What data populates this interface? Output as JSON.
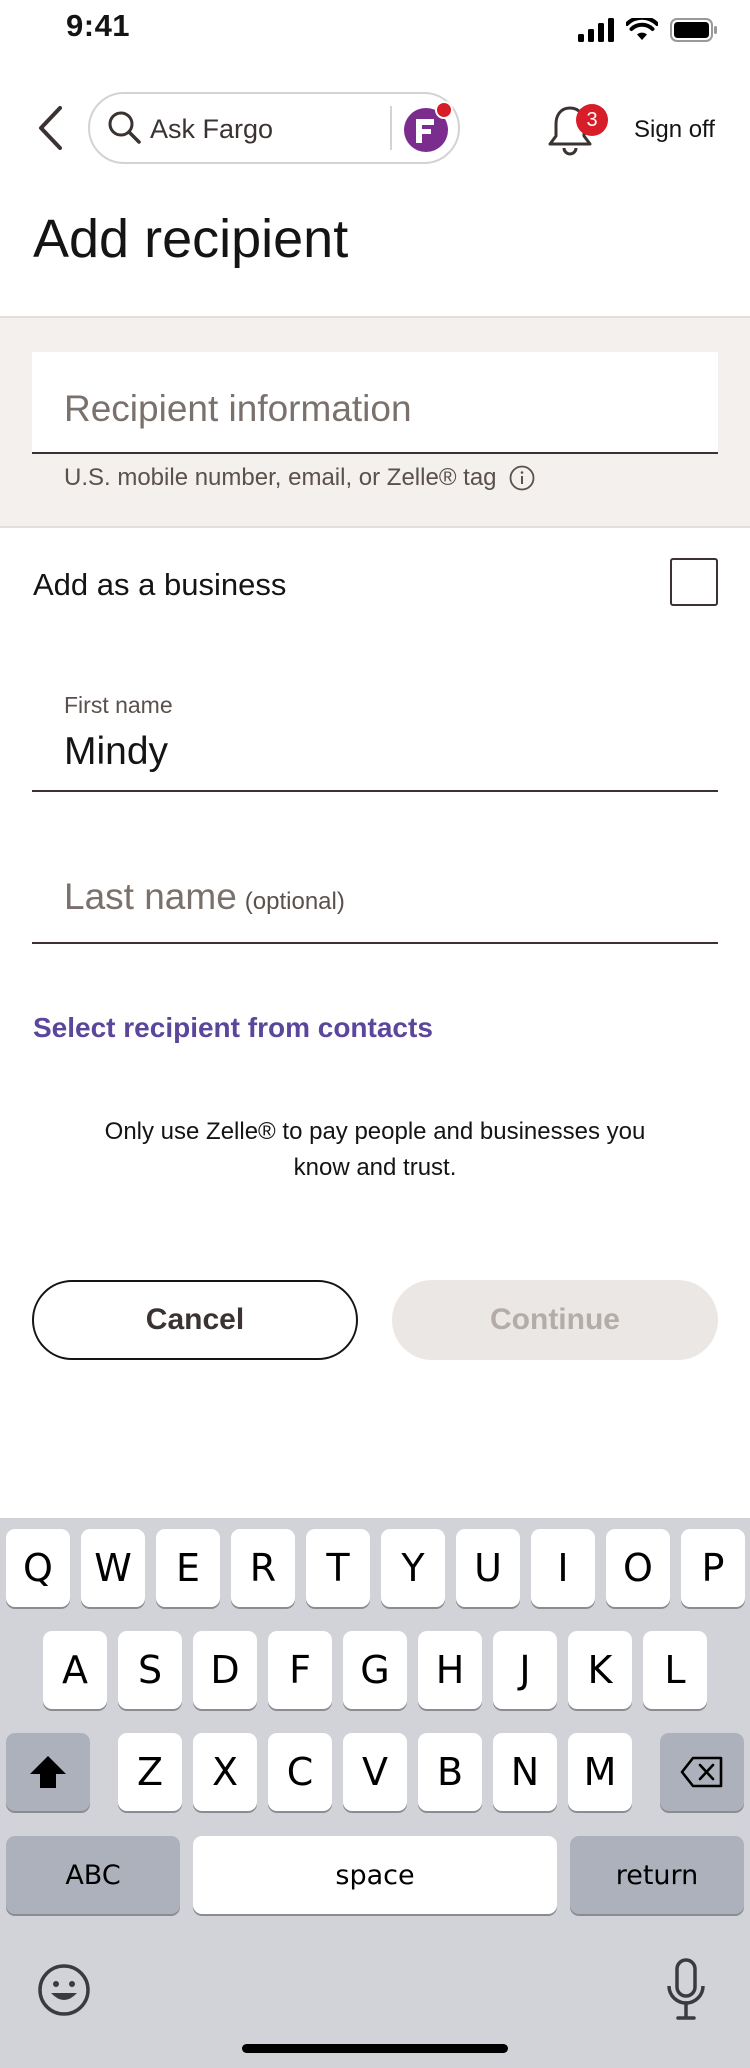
{
  "status_bar": {
    "time": "9:41"
  },
  "nav": {
    "search_text": "Ask Fargo",
    "notification_count": "3",
    "sign_off": "Sign off"
  },
  "page": {
    "title": "Add recipient"
  },
  "recipient": {
    "placeholder": "Recipient information",
    "help_text": "U.S. mobile number, email, or Zelle® tag"
  },
  "business": {
    "label": "Add as a business",
    "checked": false
  },
  "first_name": {
    "label": "First name",
    "value": "Mindy"
  },
  "last_name": {
    "placeholder": "Last name",
    "optional": "(optional)"
  },
  "contacts_link": "Select recipient from contacts",
  "disclaimer": "Only use Zelle® to pay people and businesses you know and trust.",
  "buttons": {
    "cancel": "Cancel",
    "continue": "Continue"
  },
  "keyboard": {
    "row1": [
      "Q",
      "W",
      "E",
      "R",
      "T",
      "Y",
      "U",
      "I",
      "O",
      "P"
    ],
    "row2": [
      "A",
      "S",
      "D",
      "F",
      "G",
      "H",
      "J",
      "K",
      "L"
    ],
    "row3": [
      "Z",
      "X",
      "C",
      "V",
      "B",
      "N",
      "M"
    ],
    "abc": "ABC",
    "space": "space",
    "return": "return"
  },
  "colors": {
    "link": "#5a469b",
    "badge": "#d71e28",
    "fargo": "#7b2d8e",
    "section_bg": "#f4f0ed",
    "keyboard_bg": "#d1d3d9"
  }
}
